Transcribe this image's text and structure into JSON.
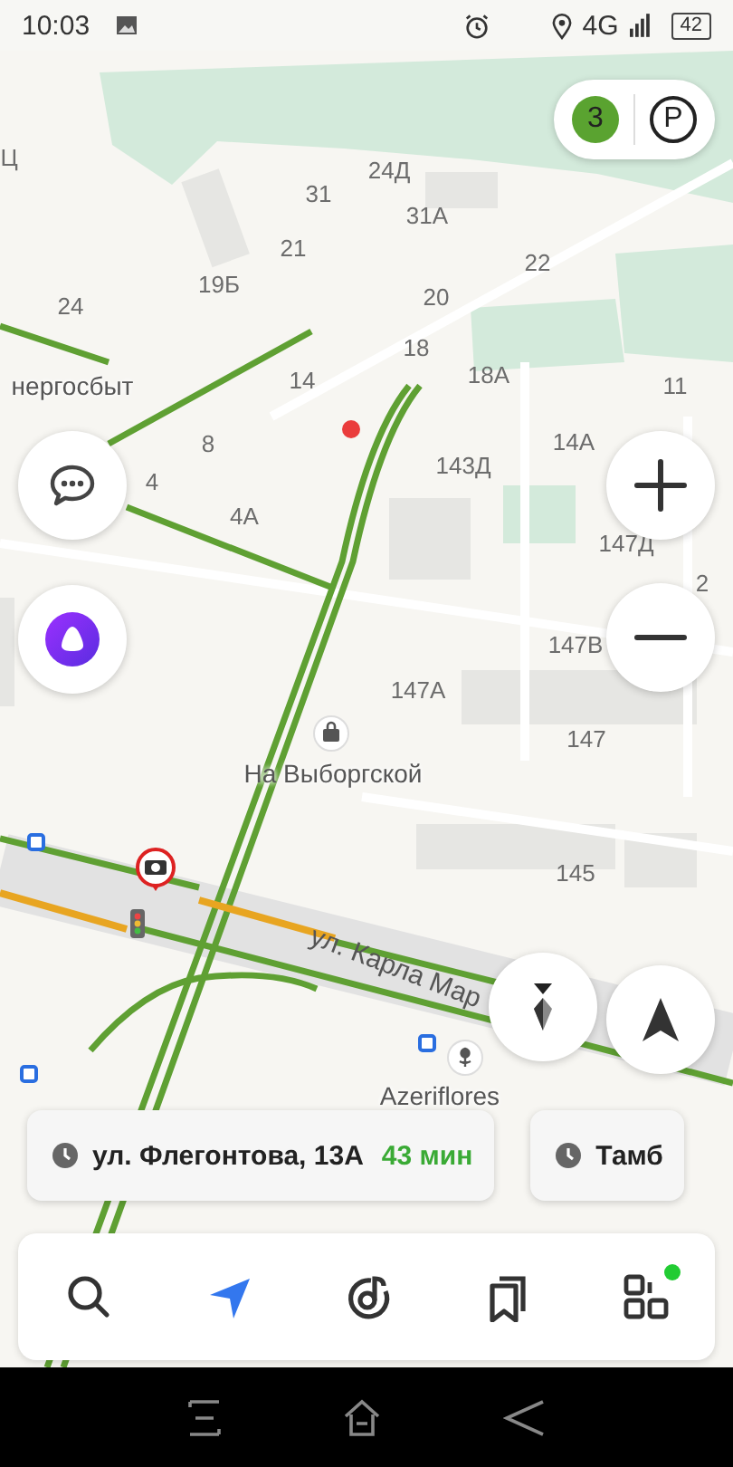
{
  "status_bar": {
    "time": "10:03",
    "network": "4G",
    "battery": "42"
  },
  "layers": {
    "traffic_score": "3",
    "parking": "P"
  },
  "map": {
    "labels": [
      {
        "text": "Ц",
        "kind": "house"
      },
      {
        "text": "31",
        "kind": "house"
      },
      {
        "text": "24Д",
        "kind": "house"
      },
      {
        "text": "31А",
        "kind": "house"
      },
      {
        "text": "21",
        "kind": "house"
      },
      {
        "text": "19Б",
        "kind": "house"
      },
      {
        "text": "22",
        "kind": "house"
      },
      {
        "text": "24",
        "kind": "house"
      },
      {
        "text": "20",
        "kind": "house"
      },
      {
        "text": "18",
        "kind": "house"
      },
      {
        "text": "нергосбыт",
        "kind": "place"
      },
      {
        "text": "14",
        "kind": "house"
      },
      {
        "text": "18А",
        "kind": "house"
      },
      {
        "text": "11",
        "kind": "house"
      },
      {
        "text": "8",
        "kind": "house"
      },
      {
        "text": "4",
        "kind": "house"
      },
      {
        "text": "4А",
        "kind": "house"
      },
      {
        "text": "143Д",
        "kind": "house"
      },
      {
        "text": "14А",
        "kind": "house"
      },
      {
        "text": "147Д",
        "kind": "house"
      },
      {
        "text": "2",
        "kind": "house"
      },
      {
        "text": "147В",
        "kind": "house"
      },
      {
        "text": "147А",
        "kind": "house"
      },
      {
        "text": "147",
        "kind": "house"
      },
      {
        "text": "На Выборгской",
        "kind": "place"
      },
      {
        "text": "145",
        "kind": "house"
      },
      {
        "text": "Azeriflores",
        "kind": "place"
      },
      {
        "text": "ул. Карла Мар",
        "kind": "street"
      }
    ]
  },
  "route_chips": [
    {
      "place": "ул. Флегонтова, 13А",
      "eta": "43 мин"
    },
    {
      "place": "Тамб"
    }
  ],
  "tab_bar": [
    {
      "kind": "search",
      "badge": false
    },
    {
      "kind": "navigator",
      "badge": false
    },
    {
      "kind": "music",
      "badge": false
    },
    {
      "kind": "bookmarks",
      "badge": false
    },
    {
      "kind": "services",
      "badge": true
    }
  ]
}
